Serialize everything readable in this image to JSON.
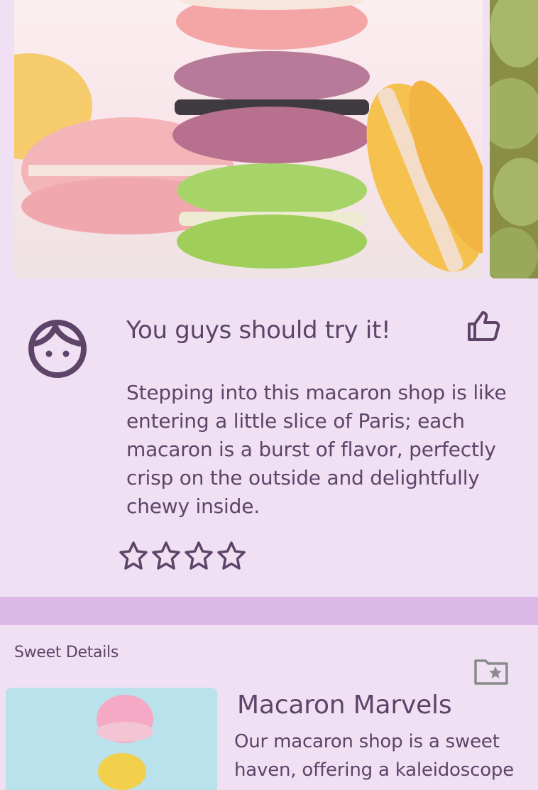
{
  "carousel": {
    "main_image": "macaron-stack-photo",
    "peek_image": "pistachio-macarons-photo"
  },
  "review": {
    "avatar_icon": "face-icon",
    "title": "You guys should try it!",
    "like_icon": "thumbs-up-icon",
    "body": "Stepping into this macaron shop is like entering a little slice of Paris; each macaron is a burst of flavor, perfectly crisp on the outside and delightfully chewy inside.",
    "rating_icon": "star-outline-icon",
    "stars_shown": 4,
    "stars_filled": 0
  },
  "details": {
    "section_label": "Sweet Details",
    "folder_icon": "folder-star-icon",
    "product_image": "macaron-on-blue-photo",
    "product_title": "Macaron Marvels",
    "product_description": "Our macaron shop is a sweet haven, offering a kaleidoscope"
  },
  "colors": {
    "background": "#efe1f3",
    "text": "#5e4468",
    "divider": "#dbb8e6",
    "muted_icon": "#8a8a8a"
  }
}
